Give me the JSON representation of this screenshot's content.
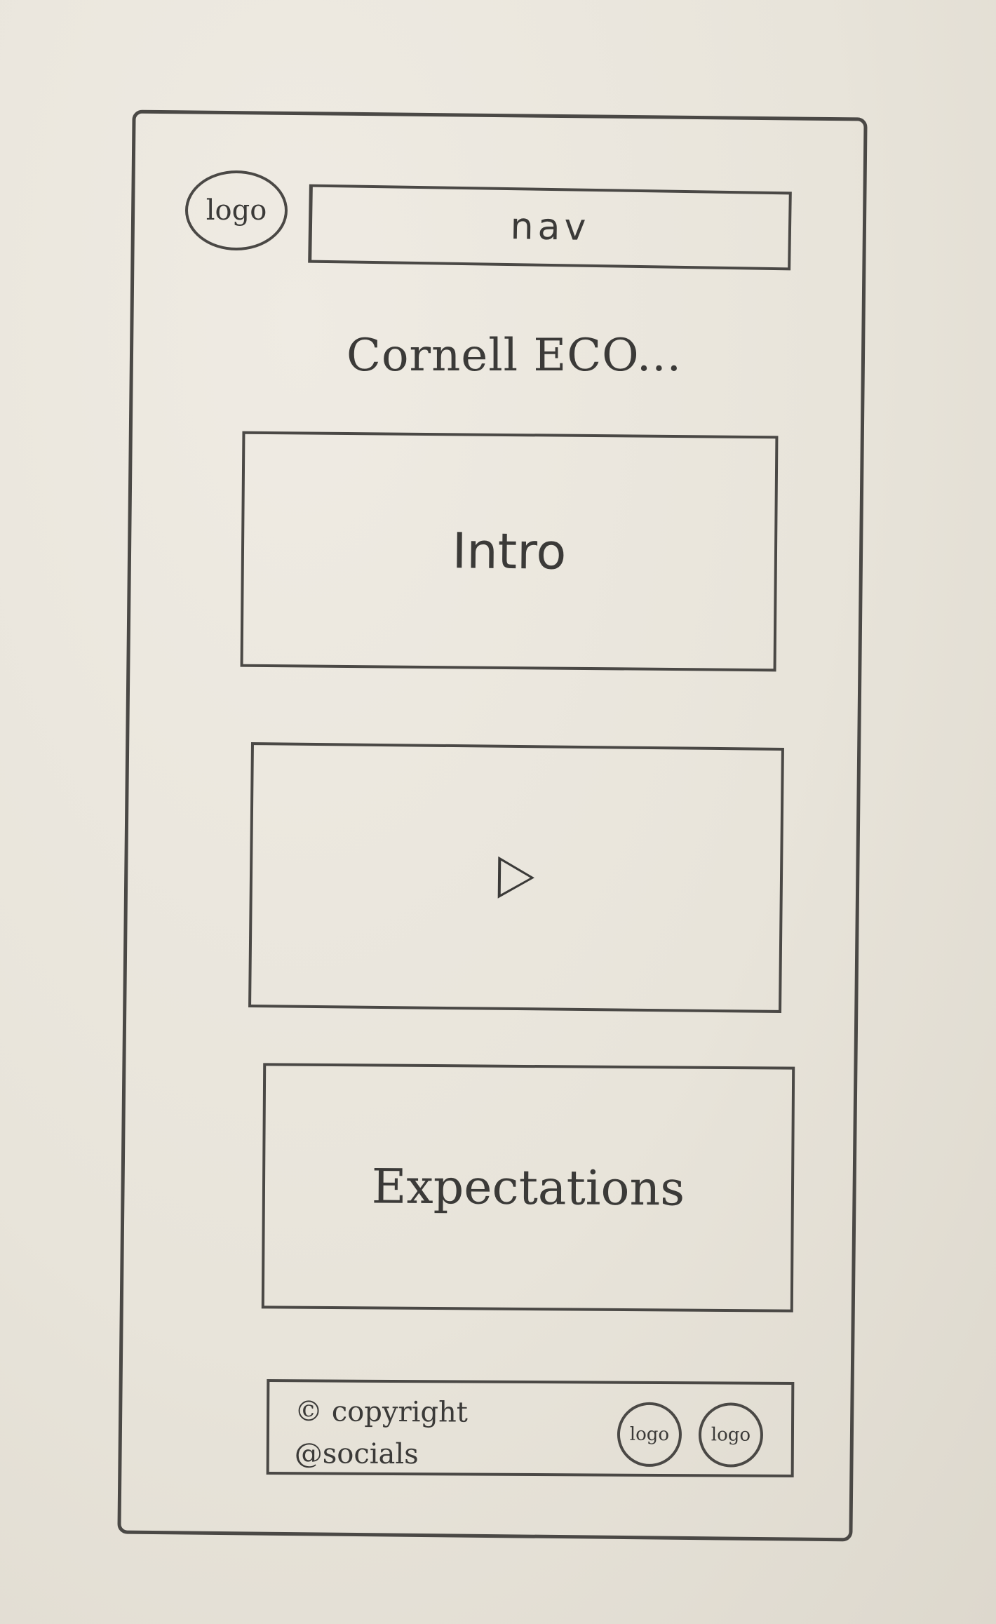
{
  "header": {
    "logo_label": "logo",
    "nav_label": "nav"
  },
  "main": {
    "title": "Cornell ECO...",
    "intro_label": "Intro",
    "video_icon": "play-icon",
    "expectations_label": "Expectations"
  },
  "footer": {
    "copyright": "© copyright",
    "socials": "@socials",
    "logos": [
      "logo",
      "logo"
    ]
  }
}
